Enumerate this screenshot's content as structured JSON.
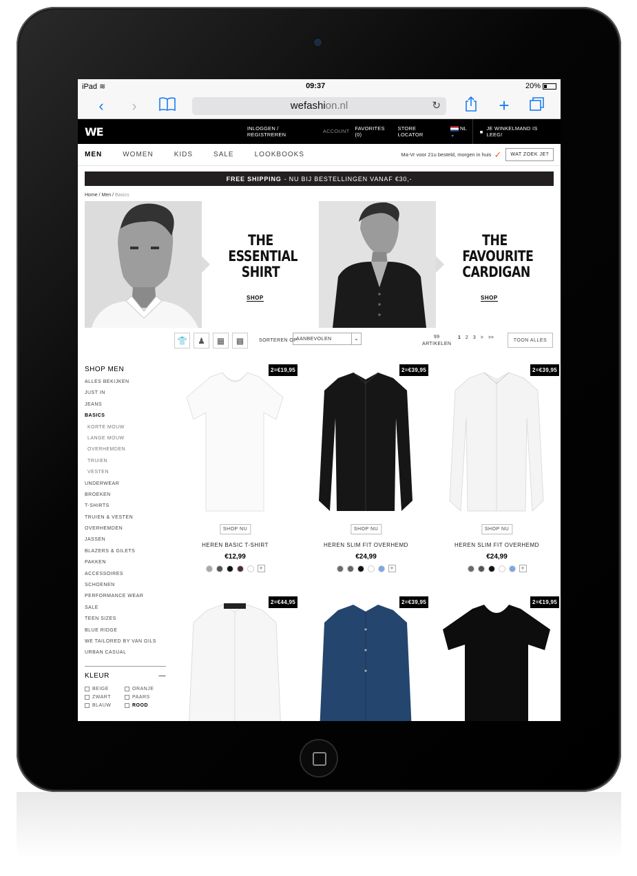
{
  "status": {
    "device": "iPad",
    "time": "09:37",
    "battery": "20%"
  },
  "browser": {
    "url_prefix": "wefashi",
    "url_suffix": "on.nl"
  },
  "topbar": {
    "logo": "WE",
    "login": "INLOGGEN / REGISTREREN",
    "account": "ACCOUNT",
    "favorites": "FAVORITES (0)",
    "store_locator": "STORE LOCATOR",
    "lang": "NL",
    "cart": "JE WINKELMAND IS LEEG!"
  },
  "mainnav": {
    "tabs": [
      "MEN",
      "WOMEN",
      "KIDS",
      "SALE",
      "LOOKBOOKS"
    ],
    "delivery": "Ma-Vr voor 21u besteld, morgen in huis",
    "search": "WAT ZOEK JE?"
  },
  "promo": {
    "bold": "FREE SHIPPING",
    "text": "- NU BIJ BESTELLINGEN VANAF €30,-"
  },
  "breadcrumb": {
    "home": "Home",
    "sep": " / ",
    "men": "Men",
    "current": "Basics"
  },
  "banners": [
    {
      "title_l1": "THE",
      "title_l2": "ESSENTIAL",
      "title_l3": "SHIRT",
      "link": "SHOP"
    },
    {
      "title_l1": "THE",
      "title_l2": "FAVOURITE",
      "title_l3": "CARDIGAN",
      "link": "SHOP"
    }
  ],
  "toolbar": {
    "sort_label": "SORTEREN OP:",
    "sort_value": "AANBEVOLEN",
    "count_num": "99",
    "count_label": "ARTIKELEN",
    "pages": [
      "1",
      "2",
      "3",
      ">",
      ">>"
    ],
    "show_all": "TOON ALLES"
  },
  "sidebar": {
    "title": "SHOP MEN",
    "categories": [
      "ALLES BEKIJKEN",
      "JUST IN",
      "JEANS",
      "BASICS",
      "KORTE MOUW",
      "LANGE MOUW",
      "OVERHEMDEN",
      "TRUIEN",
      "VESTEN",
      "UNDERWEAR",
      "BROEKEN",
      "T-SHIRTS",
      "TRUIEN & VESTEN",
      "OVERHEMDEN",
      "JASSEN",
      "BLAZERS & GILETS",
      "PAKKEN",
      "ACCESSOIRES",
      "SCHOENEN",
      "PERFORMANCE WEAR",
      "SALE",
      "TEEN SIZES",
      "BLUE RIDGE",
      "WE TAILORED BY VAN GILS",
      "URBAN CASUAL"
    ],
    "kleur_title": "KLEUR",
    "kleur_toggle": "—",
    "colors": [
      "BEIGE",
      "ORANJE",
      "ZWART",
      "PAARS",
      "BLAUW",
      "ROOD"
    ]
  },
  "products": [
    {
      "badge": "2=€19,95",
      "shop": "SHOP NU",
      "name": "HEREN BASIC T-SHIRT",
      "price": "€12,99",
      "swatches": [
        "#a9a9a9",
        "#555555",
        "#111111",
        "#4a2b3f",
        "#ffffff"
      ]
    },
    {
      "badge": "2=€39,95",
      "shop": "SHOP NU",
      "name": "HEREN SLIM FIT OVERHEMD",
      "price": "€24,99",
      "swatches": [
        "#6b6b6b",
        "#666666",
        "#111111",
        "#ffffff",
        "#7aa7e8"
      ]
    },
    {
      "badge": "2=€39,95",
      "shop": "SHOP NU",
      "name": "HEREN SLIM FIT OVERHEMD",
      "price": "€24,99",
      "swatches": [
        "#6b6b6b",
        "#555555",
        "#111111",
        "#ffffff",
        "#7aa7e8"
      ]
    },
    {
      "badge": "2=€44,95"
    },
    {
      "badge": "2=€39,95"
    },
    {
      "badge": "2=€19,95"
    }
  ],
  "colors": {
    "accent_check": "#f06022",
    "safari_blue": "#1a7cf0",
    "promo_bg": "#231f20"
  }
}
